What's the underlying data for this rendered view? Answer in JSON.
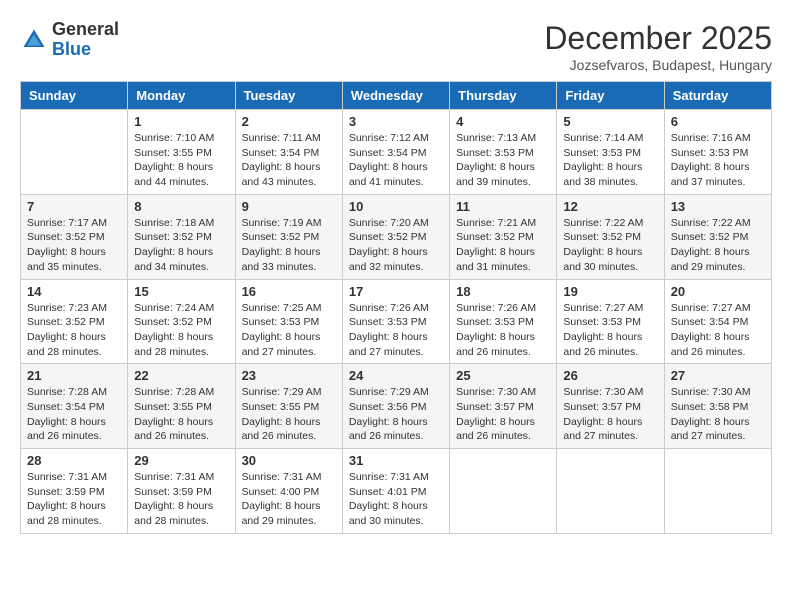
{
  "header": {
    "logo_general": "General",
    "logo_blue": "Blue",
    "month_title": "December 2025",
    "location": "Jozsefvaros, Budapest, Hungary"
  },
  "weekdays": [
    "Sunday",
    "Monday",
    "Tuesday",
    "Wednesday",
    "Thursday",
    "Friday",
    "Saturday"
  ],
  "weeks": [
    [
      {
        "day": "",
        "info": ""
      },
      {
        "day": "1",
        "info": "Sunrise: 7:10 AM\nSunset: 3:55 PM\nDaylight: 8 hours\nand 44 minutes."
      },
      {
        "day": "2",
        "info": "Sunrise: 7:11 AM\nSunset: 3:54 PM\nDaylight: 8 hours\nand 43 minutes."
      },
      {
        "day": "3",
        "info": "Sunrise: 7:12 AM\nSunset: 3:54 PM\nDaylight: 8 hours\nand 41 minutes."
      },
      {
        "day": "4",
        "info": "Sunrise: 7:13 AM\nSunset: 3:53 PM\nDaylight: 8 hours\nand 39 minutes."
      },
      {
        "day": "5",
        "info": "Sunrise: 7:14 AM\nSunset: 3:53 PM\nDaylight: 8 hours\nand 38 minutes."
      },
      {
        "day": "6",
        "info": "Sunrise: 7:16 AM\nSunset: 3:53 PM\nDaylight: 8 hours\nand 37 minutes."
      }
    ],
    [
      {
        "day": "7",
        "info": "Sunrise: 7:17 AM\nSunset: 3:52 PM\nDaylight: 8 hours\nand 35 minutes."
      },
      {
        "day": "8",
        "info": "Sunrise: 7:18 AM\nSunset: 3:52 PM\nDaylight: 8 hours\nand 34 minutes."
      },
      {
        "day": "9",
        "info": "Sunrise: 7:19 AM\nSunset: 3:52 PM\nDaylight: 8 hours\nand 33 minutes."
      },
      {
        "day": "10",
        "info": "Sunrise: 7:20 AM\nSunset: 3:52 PM\nDaylight: 8 hours\nand 32 minutes."
      },
      {
        "day": "11",
        "info": "Sunrise: 7:21 AM\nSunset: 3:52 PM\nDaylight: 8 hours\nand 31 minutes."
      },
      {
        "day": "12",
        "info": "Sunrise: 7:22 AM\nSunset: 3:52 PM\nDaylight: 8 hours\nand 30 minutes."
      },
      {
        "day": "13",
        "info": "Sunrise: 7:22 AM\nSunset: 3:52 PM\nDaylight: 8 hours\nand 29 minutes."
      }
    ],
    [
      {
        "day": "14",
        "info": "Sunrise: 7:23 AM\nSunset: 3:52 PM\nDaylight: 8 hours\nand 28 minutes."
      },
      {
        "day": "15",
        "info": "Sunrise: 7:24 AM\nSunset: 3:52 PM\nDaylight: 8 hours\nand 28 minutes."
      },
      {
        "day": "16",
        "info": "Sunrise: 7:25 AM\nSunset: 3:53 PM\nDaylight: 8 hours\nand 27 minutes."
      },
      {
        "day": "17",
        "info": "Sunrise: 7:26 AM\nSunset: 3:53 PM\nDaylight: 8 hours\nand 27 minutes."
      },
      {
        "day": "18",
        "info": "Sunrise: 7:26 AM\nSunset: 3:53 PM\nDaylight: 8 hours\nand 26 minutes."
      },
      {
        "day": "19",
        "info": "Sunrise: 7:27 AM\nSunset: 3:53 PM\nDaylight: 8 hours\nand 26 minutes."
      },
      {
        "day": "20",
        "info": "Sunrise: 7:27 AM\nSunset: 3:54 PM\nDaylight: 8 hours\nand 26 minutes."
      }
    ],
    [
      {
        "day": "21",
        "info": "Sunrise: 7:28 AM\nSunset: 3:54 PM\nDaylight: 8 hours\nand 26 minutes."
      },
      {
        "day": "22",
        "info": "Sunrise: 7:28 AM\nSunset: 3:55 PM\nDaylight: 8 hours\nand 26 minutes."
      },
      {
        "day": "23",
        "info": "Sunrise: 7:29 AM\nSunset: 3:55 PM\nDaylight: 8 hours\nand 26 minutes."
      },
      {
        "day": "24",
        "info": "Sunrise: 7:29 AM\nSunset: 3:56 PM\nDaylight: 8 hours\nand 26 minutes."
      },
      {
        "day": "25",
        "info": "Sunrise: 7:30 AM\nSunset: 3:57 PM\nDaylight: 8 hours\nand 26 minutes."
      },
      {
        "day": "26",
        "info": "Sunrise: 7:30 AM\nSunset: 3:57 PM\nDaylight: 8 hours\nand 27 minutes."
      },
      {
        "day": "27",
        "info": "Sunrise: 7:30 AM\nSunset: 3:58 PM\nDaylight: 8 hours\nand 27 minutes."
      }
    ],
    [
      {
        "day": "28",
        "info": "Sunrise: 7:31 AM\nSunset: 3:59 PM\nDaylight: 8 hours\nand 28 minutes."
      },
      {
        "day": "29",
        "info": "Sunrise: 7:31 AM\nSunset: 3:59 PM\nDaylight: 8 hours\nand 28 minutes."
      },
      {
        "day": "30",
        "info": "Sunrise: 7:31 AM\nSunset: 4:00 PM\nDaylight: 8 hours\nand 29 minutes."
      },
      {
        "day": "31",
        "info": "Sunrise: 7:31 AM\nSunset: 4:01 PM\nDaylight: 8 hours\nand 30 minutes."
      },
      {
        "day": "",
        "info": ""
      },
      {
        "day": "",
        "info": ""
      },
      {
        "day": "",
        "info": ""
      }
    ]
  ]
}
